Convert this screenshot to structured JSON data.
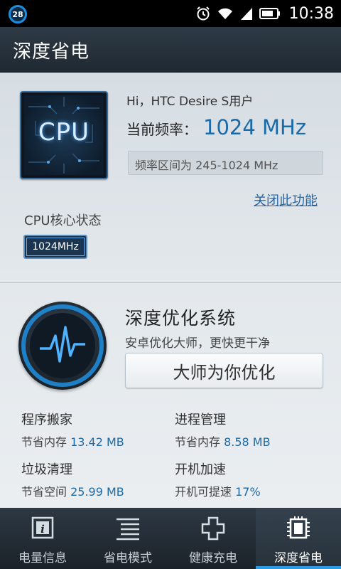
{
  "status_bar": {
    "notification_count": "28",
    "time": "10:38",
    "icons": [
      "alarm-icon",
      "wifi-icon",
      "signal-icon",
      "battery-icon"
    ]
  },
  "header": {
    "title": "深度省电"
  },
  "cpu": {
    "chip_label": "CPU",
    "greeting": "Hi，HTC Desire S用户",
    "freq_label": "当前频率：",
    "freq_value": "1024 MHz",
    "freq_range": "频率区间为 245-1024 MHz",
    "close_link": "关闭此功能",
    "core_title": "CPU核心状态",
    "core_badge": "1024MHz"
  },
  "optimize": {
    "title": "深度优化系统",
    "subtitle": "安卓优化大师，更快更干净",
    "button": "大师为你优化",
    "stats": [
      {
        "name": "程序搬家",
        "prefix": "节省内存 ",
        "value": "13.42 MB"
      },
      {
        "name": "进程管理",
        "prefix": "节省内存 ",
        "value": "8.58 MB"
      },
      {
        "name": "垃圾清理",
        "prefix": "节省空间 ",
        "value": "25.99 MB"
      },
      {
        "name": "开机加速",
        "prefix": "开机可提速 ",
        "value": "17%"
      }
    ]
  },
  "nav": {
    "items": [
      {
        "label": "电量信息",
        "icon": "info-icon"
      },
      {
        "label": "省电模式",
        "icon": "list-icon"
      },
      {
        "label": "健康充电",
        "icon": "plus-icon"
      },
      {
        "label": "深度省电",
        "icon": "chip-icon"
      }
    ],
    "active_index": 3
  },
  "colors": {
    "accent": "#2b9be8",
    "value_blue": "#1a6aa8"
  }
}
